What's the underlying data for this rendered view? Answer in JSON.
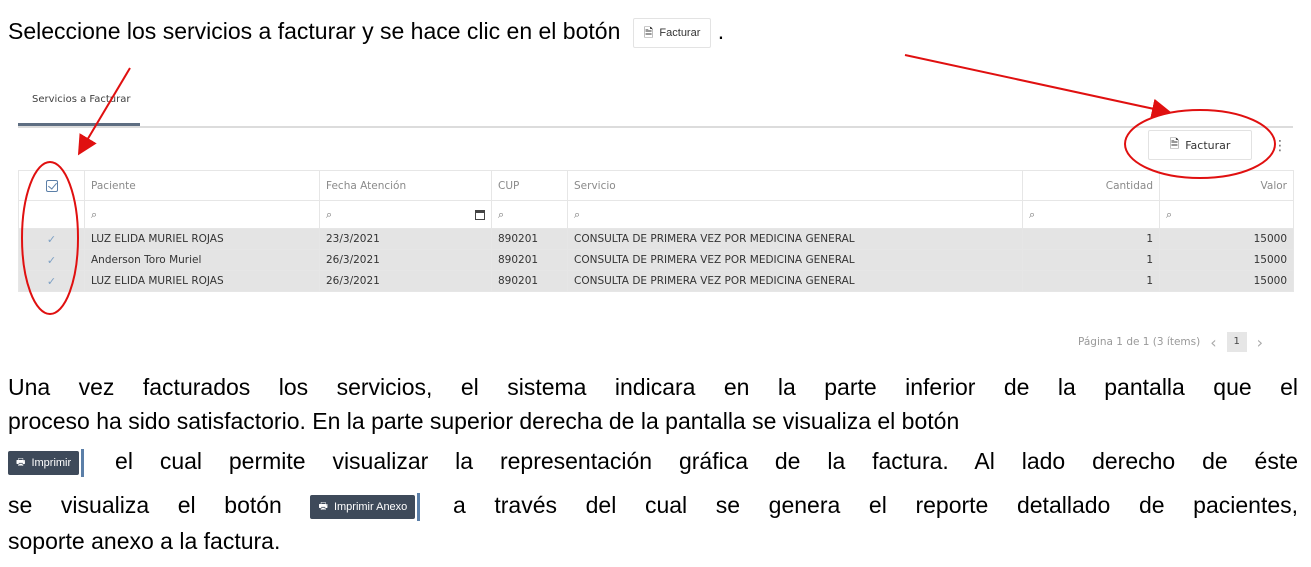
{
  "intro": {
    "text": "Seleccione los servicios a facturar y se hace clic en el botón",
    "button_label": "Facturar",
    "trail": "."
  },
  "screen": {
    "tab_label": "Servicios a Facturar",
    "facturar_button": "Facturar",
    "columns": [
      "Paciente",
      "Fecha Atención",
      "CUP",
      "Servicio",
      "Cantidad",
      "Valor"
    ],
    "rows": [
      {
        "paciente": "LUZ ELIDA MURIEL ROJAS",
        "fecha": "23/3/2021",
        "cup": "890201",
        "servicio": "CONSULTA DE PRIMERA VEZ POR MEDICINA GENERAL",
        "cantidad": "1",
        "valor": "15000"
      },
      {
        "paciente": "Anderson Toro Muriel",
        "fecha": "26/3/2021",
        "cup": "890201",
        "servicio": "CONSULTA DE PRIMERA VEZ POR MEDICINA GENERAL",
        "cantidad": "1",
        "valor": "15000"
      },
      {
        "paciente": "LUZ ELIDA MURIEL ROJAS",
        "fecha": "26/3/2021",
        "cup": "890201",
        "servicio": "CONSULTA DE PRIMERA VEZ POR MEDICINA GENERAL",
        "cantidad": "1",
        "valor": "15000"
      }
    ],
    "pager_text": "Página 1 de 1 (3 ítems)",
    "pager_page": "1"
  },
  "paragraph": {
    "line1": "Una vez facturados los servicios, el sistema indicara en la parte inferior de la pantalla que el",
    "line2": "proceso ha sido satisfactorio. En la parte superior derecha de la pantalla se visualiza el botón",
    "imprimir_label": "Imprimir",
    "line3": "el cual permite visualizar la representación gráfica de la factura. Al lado derecho de éste",
    "line4_a": "se visualiza el botón",
    "imprimir_anexo_label": "Imprimir Anexo",
    "line4_b": "a través del cual se genera el reporte detallado de pacientes,",
    "line5": "soporte anexo a la factura."
  },
  "colors": {
    "annotation": "#e01010",
    "header_dark": "#3e4a5a",
    "row_selected": "#e4e4e4"
  }
}
